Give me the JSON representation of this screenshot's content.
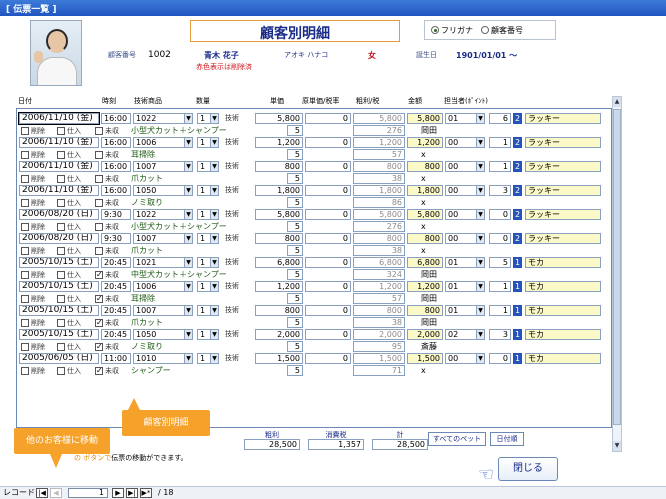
{
  "window_title": "[ 伝票一覧 ]",
  "page_title": "顧客別明細",
  "sort_options": {
    "furigana": "フリガナ",
    "customer_number": "顧客番号",
    "selected": "furigana"
  },
  "customer": {
    "number_label": "顧客番号",
    "number": "1002",
    "name": "青木 花子",
    "kana": "アオキ ハナコ",
    "gender": "女",
    "birthday_label": "誕生日",
    "birthday": "1901/01/01 〜",
    "note": "赤色表示は削除済"
  },
  "columns": {
    "date": "日付",
    "time": "時刻",
    "service": "技術商品",
    "qty": "数量",
    "unit": "単価",
    "cost": "原単価/税率",
    "profit": "粗利/税",
    "amount": "金額",
    "staff": "担当者(ﾎﾟｲﾝﾄ)"
  },
  "row_labels": {
    "delete": "削除",
    "stock": "仕入",
    "unpaid": "未収",
    "type": "技術"
  },
  "rows": [
    {
      "date": "2006/11/10 (金)",
      "time": "16:00",
      "code": "1022",
      "qty": "1",
      "unit": "5,800",
      "cost": "0",
      "profit": "5,800",
      "amount": "5,800",
      "pt_code": "01",
      "pt": "6",
      "staff_no": "2",
      "staff": "ラッキー",
      "rate": "5",
      "tax": "276",
      "menu": "小型犬カット＋シャンプー",
      "note": "岡田",
      "unpaid": false,
      "selected": true
    },
    {
      "date": "2006/11/10 (金)",
      "time": "16:00",
      "code": "1006",
      "qty": "1",
      "unit": "1,200",
      "cost": "0",
      "profit": "1,200",
      "amount": "1,200",
      "pt_code": "00",
      "pt": "1",
      "staff_no": "2",
      "staff": "ラッキー",
      "rate": "5",
      "tax": "57",
      "menu": "耳掃除",
      "note": "x",
      "unpaid": false,
      "selected": false
    },
    {
      "date": "2006/11/10 (金)",
      "time": "16:00",
      "code": "1007",
      "qty": "1",
      "unit": "800",
      "cost": "0",
      "profit": "800",
      "amount": "800",
      "pt_code": "00",
      "pt": "1",
      "staff_no": "2",
      "staff": "ラッキー",
      "rate": "5",
      "tax": "38",
      "menu": "爪カット",
      "note": "x",
      "unpaid": false,
      "selected": false
    },
    {
      "date": "2006/11/10 (金)",
      "time": "16:00",
      "code": "1050",
      "qty": "1",
      "unit": "1,800",
      "cost": "0",
      "profit": "1,800",
      "amount": "1,800",
      "pt_code": "00",
      "pt": "3",
      "staff_no": "2",
      "staff": "ラッキー",
      "rate": "5",
      "tax": "86",
      "menu": "ノミ取り",
      "note": "x",
      "unpaid": false,
      "selected": false
    },
    {
      "date": "2006/08/20 (日)",
      "time": "9:30",
      "code": "1022",
      "qty": "1",
      "unit": "5,800",
      "cost": "0",
      "profit": "5,800",
      "amount": "5,800",
      "pt_code": "00",
      "pt": "0",
      "staff_no": "2",
      "staff": "ラッキー",
      "rate": "5",
      "tax": "276",
      "menu": "小型犬カット＋シャンプー",
      "note": "x",
      "unpaid": false,
      "selected": false
    },
    {
      "date": "2006/08/20 (日)",
      "time": "9:30",
      "code": "1007",
      "qty": "1",
      "unit": "800",
      "cost": "0",
      "profit": "800",
      "amount": "800",
      "pt_code": "00",
      "pt": "0",
      "staff_no": "2",
      "staff": "ラッキー",
      "rate": "5",
      "tax": "38",
      "menu": "爪カット",
      "note": "x",
      "unpaid": false,
      "selected": false
    },
    {
      "date": "2005/10/15 (土)",
      "time": "20:45",
      "code": "1021",
      "qty": "1",
      "unit": "6,800",
      "cost": "0",
      "profit": "6,800",
      "amount": "6,800",
      "pt_code": "01",
      "pt": "5",
      "staff_no": "1",
      "staff": "モカ",
      "rate": "5",
      "tax": "324",
      "menu": "中型犬カット＋シャンプー",
      "note": "岡田",
      "unpaid": true,
      "selected": false
    },
    {
      "date": "2005/10/15 (土)",
      "time": "20:45",
      "code": "1006",
      "qty": "1",
      "unit": "1,200",
      "cost": "0",
      "profit": "1,200",
      "amount": "1,200",
      "pt_code": "01",
      "pt": "1",
      "staff_no": "1",
      "staff": "モカ",
      "rate": "5",
      "tax": "57",
      "menu": "耳掃除",
      "note": "岡田",
      "unpaid": true,
      "selected": false
    },
    {
      "date": "2005/10/15 (土)",
      "time": "20:45",
      "code": "1007",
      "qty": "1",
      "unit": "800",
      "cost": "0",
      "profit": "800",
      "amount": "800",
      "pt_code": "01",
      "pt": "1",
      "staff_no": "1",
      "staff": "モカ",
      "rate": "5",
      "tax": "38",
      "menu": "爪カット",
      "note": "岡田",
      "unpaid": true,
      "selected": false
    },
    {
      "date": "2005/10/15 (土)",
      "time": "20:45",
      "code": "1050",
      "qty": "1",
      "unit": "2,000",
      "cost": "0",
      "profit": "2,000",
      "amount": "2,000",
      "pt_code": "02",
      "pt": "3",
      "staff_no": "1",
      "staff": "モカ",
      "rate": "5",
      "tax": "95",
      "menu": "ノミ取り",
      "note": "斎藤",
      "unpaid": true,
      "selected": false
    },
    {
      "date": "2005/06/05 (日)",
      "time": "11:00",
      "code": "1010",
      "qty": "1",
      "unit": "1,500",
      "cost": "0",
      "profit": "1,500",
      "amount": "1,500",
      "pt_code": "00",
      "pt": "0",
      "staff_no": "1",
      "staff": "モカ",
      "rate": "5",
      "tax": "71",
      "menu": "シャンプー",
      "note": "x",
      "unpaid": true,
      "selected": false
    }
  ],
  "totals": {
    "profit_label": "粗利",
    "profit": "28,500",
    "tax_label": "消費税",
    "tax": "1,357",
    "total_label": "計",
    "total": "28,500"
  },
  "buttons": {
    "all_pets": "すべてのペット",
    "date_order": "日付順",
    "close": "閉じる"
  },
  "callouts": {
    "detail": "顧客別明細",
    "move": "他のお客様に移動"
  },
  "hint": {
    "prefix": "の",
    "mid": "ボタンで",
    "suffix": "伝票の移動ができます。"
  },
  "record_bar": {
    "label": "レコード:",
    "current": "1",
    "total": "/ 18"
  },
  "colors": {
    "accent": "#2653b9",
    "callout": "#f5a12a",
    "title": "#1a2b88",
    "highlight": "#fbf9c8"
  }
}
